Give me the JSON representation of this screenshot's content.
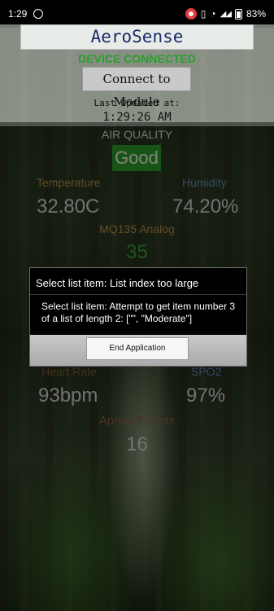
{
  "status_bar": {
    "time": "1:29",
    "battery_percent": "83%"
  },
  "app": {
    "title": "AeroSense",
    "device_status": "DEVICE CONNECTED",
    "connect_button": "Connect to Module",
    "last_updated_label": "Last Updated at:",
    "last_updated_time": "1:29:26 AM"
  },
  "readings": {
    "air_quality_label": "AIR QUALITY",
    "air_quality_value": "Good",
    "temperature_label": "Temperature",
    "temperature_value": "32.80C",
    "humidity_label": "Humidity",
    "humidity_value": "74.20%",
    "mq135_label": "MQ135 Analog",
    "mq135_value": "35",
    "heart_rate_label": "Heart Rate",
    "heart_rate_value": "93bpm",
    "spo2_label": "SPO2",
    "spo2_value": "97%",
    "apnea_label": "Apnea Events",
    "apnea_value": "16"
  },
  "dialog": {
    "title": "Select list item: List index too large",
    "message": "Select list item: Attempt to get item number 3 of a list of length 2: [\"\", \"Moderate\"]",
    "button": "End Application"
  },
  "colors": {
    "connected": "#2aa02a",
    "good_badge": "#2f9a2a",
    "title_text": "#1a2a6b"
  }
}
